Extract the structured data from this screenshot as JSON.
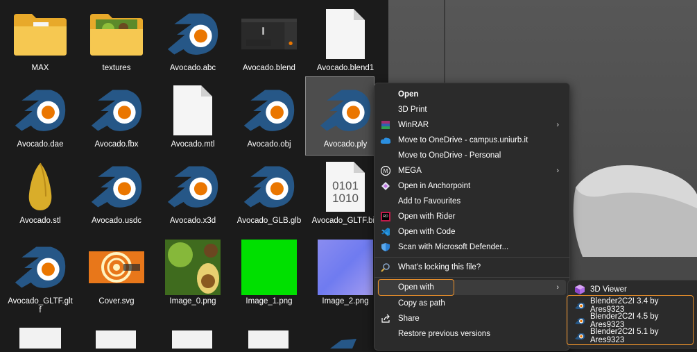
{
  "files": [
    {
      "name": "MAX",
      "type": "folder"
    },
    {
      "name": "textures",
      "type": "folder-image"
    },
    {
      "name": "Avocado.abc",
      "type": "blender"
    },
    {
      "name": "Avocado.blend",
      "type": "blend-thumb"
    },
    {
      "name": "Avocado.blend1",
      "type": "blank"
    },
    {
      "name": "Avocado.dae",
      "type": "blender"
    },
    {
      "name": "Avocado.fbx",
      "type": "blender"
    },
    {
      "name": "Avocado.mtl",
      "type": "blank"
    },
    {
      "name": "Avocado.obj",
      "type": "blender"
    },
    {
      "name": "Avocado.ply",
      "type": "blender"
    },
    {
      "name": "Avocado.stl",
      "type": "avocado"
    },
    {
      "name": "Avocado.usdc",
      "type": "blender"
    },
    {
      "name": "Avocado.x3d",
      "type": "blender"
    },
    {
      "name": "Avocado_GLB.glb",
      "type": "blender"
    },
    {
      "name": "Avocado_GLTF.bin",
      "type": "binary"
    },
    {
      "name": "Avocado_GLTF.gltf",
      "type": "blender"
    },
    {
      "name": "Cover.svg",
      "type": "cover"
    },
    {
      "name": "Image_0.png",
      "type": "image0"
    },
    {
      "name": "Image_1.png",
      "type": "image1"
    },
    {
      "name": "Image_2.png",
      "type": "image2"
    }
  ],
  "binary_glyph": {
    "line1": "0101",
    "line2": "1010"
  },
  "context_menu": {
    "items": [
      {
        "label": "Open",
        "bold": true
      },
      {
        "label": "3D Print"
      },
      {
        "label": "WinRAR",
        "arrow": "›"
      },
      {
        "label": "Move to OneDrive - campus.uniurb.it"
      },
      {
        "label": "Move to OneDrive - Personal"
      },
      {
        "label": "MEGA",
        "arrow": "›"
      },
      {
        "label": "Open in Anchorpoint"
      },
      {
        "label": "Add to Favourites"
      },
      {
        "label": "Open with Rider"
      },
      {
        "label": "Open with Code"
      },
      {
        "label": "Scan with Microsoft Defender..."
      },
      {
        "label": "What's locking this file?"
      },
      {
        "label": "Open with",
        "arrow": "›"
      },
      {
        "label": "Copy as path"
      },
      {
        "label": "Share"
      },
      {
        "label": "Restore previous versions"
      }
    ]
  },
  "submenu": {
    "items": [
      {
        "label": "3D Viewer"
      },
      {
        "label": "Blender2C2I 3.4 by Ares9323"
      },
      {
        "label": "Blender2C2I 4.5 by Ares9323"
      },
      {
        "label": "Blender2C2I 5.1 by Ares9323"
      }
    ]
  },
  "colors": {
    "highlight": "#f0932b",
    "blender_blue": "#265787",
    "blender_orange": "#ea7600"
  }
}
